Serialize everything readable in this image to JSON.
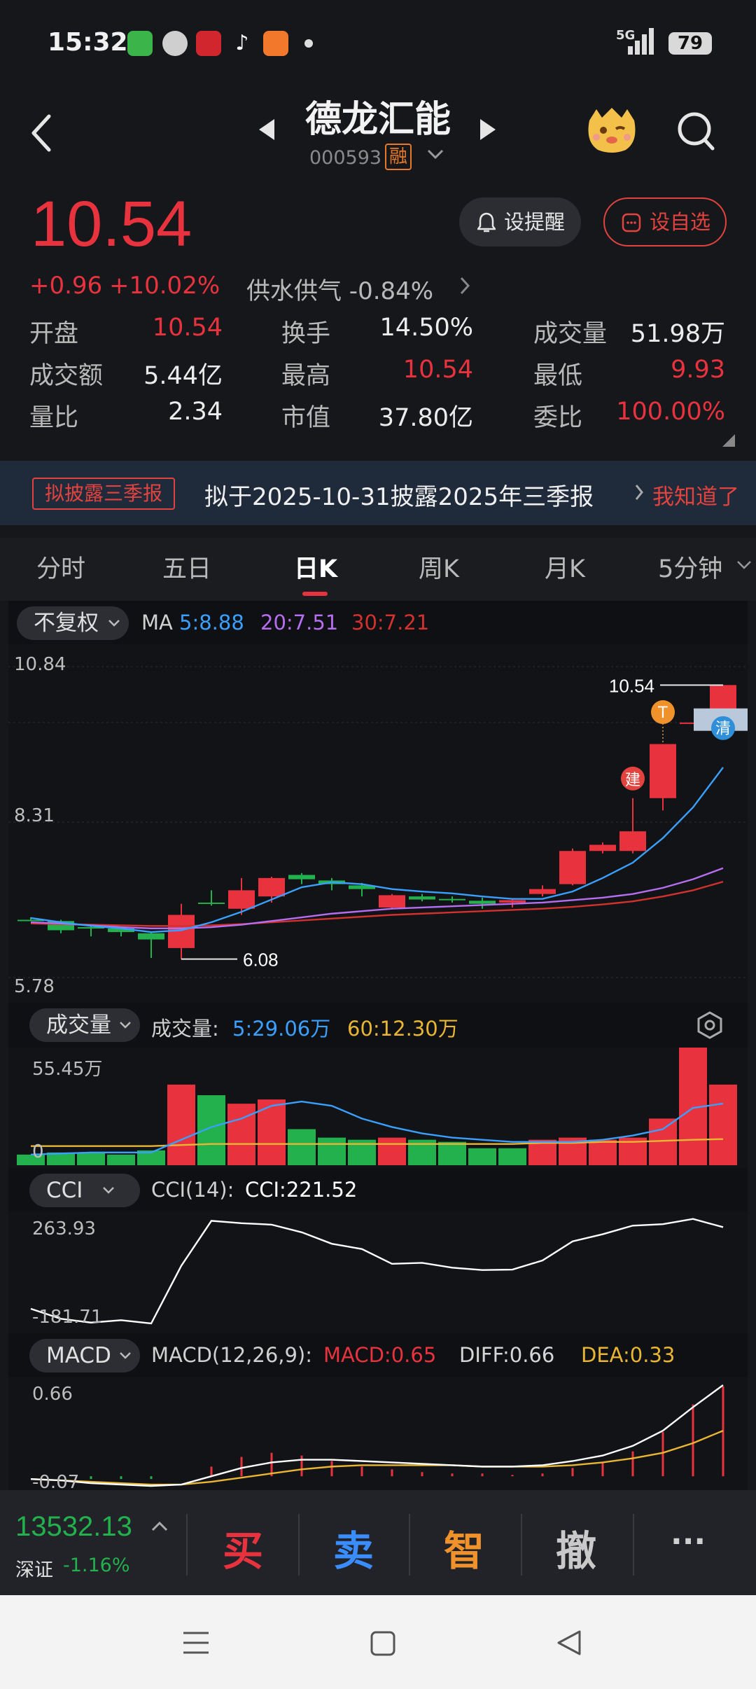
{
  "status_bar": {
    "time": "15:32",
    "network": "5G",
    "battery": "79",
    "app_icons": [
      "message-icon",
      "photo-icon",
      "cms-app-icon",
      "tiktok-icon",
      "video-app-icon"
    ]
  },
  "header": {
    "title": "德龙汇能",
    "code": "000593",
    "margin_badge": "融"
  },
  "quote": {
    "price": "10.54",
    "change": "+0.96",
    "change_pct": "+10.02%",
    "sector": "供水供气 -0.84%",
    "alert_button": "设提醒",
    "fav_button": "设自选"
  },
  "stats": [
    {
      "label": "开盘",
      "value": "10.54",
      "color": "#e8333f"
    },
    {
      "label": "换手",
      "value": "14.50%",
      "color": "#ececec"
    },
    {
      "label": "成交量",
      "value": "51.98万",
      "color": "#ececec"
    },
    {
      "label": "成交额",
      "value": "5.44亿",
      "color": "#ececec"
    },
    {
      "label": "最高",
      "value": "10.54",
      "color": "#e8333f"
    },
    {
      "label": "最低",
      "value": "9.93",
      "color": "#e8333f"
    },
    {
      "label": "量比",
      "value": "2.34",
      "color": "#ececec"
    },
    {
      "label": "市值",
      "value": "37.80亿",
      "color": "#ececec"
    },
    {
      "label": "委比",
      "value": "100.00%",
      "color": "#e8333f"
    }
  ],
  "notice": {
    "tag": "拟披露三季报",
    "text": "拟于2025-10-31披露2025年三季报",
    "dismiss": "我知道了"
  },
  "tabs": [
    "分时",
    "五日",
    "日K",
    "周K",
    "月K",
    "5分钟"
  ],
  "active_tab": "日K",
  "kline": {
    "adjust": "不复权",
    "ma_label": "MA",
    "ma5": "5:8.88",
    "ma20": "20:7.51",
    "ma30": "30:7.21",
    "y_high": "10.84",
    "y_mid": "8.31",
    "y_low": "5.78",
    "max_label": "10.54",
    "min_label": "6.08",
    "marker_build": "建",
    "marker_t": "T",
    "marker_clear": "清"
  },
  "volume": {
    "selector": "成交量",
    "label": "成交量:",
    "ma5": "5:29.06万",
    "ma60": "60:12.30万",
    "y_top": "55.45万",
    "y_zero": "0"
  },
  "cci": {
    "selector": "CCI",
    "params": "CCI(14):",
    "value": "CCI:221.52",
    "y_top": "263.93",
    "y_bottom": "-181.71"
  },
  "macd": {
    "selector": "MACD",
    "params": "MACD(12,26,9):",
    "macd": "MACD:0.65",
    "diff": "DIFF:0.66",
    "dea": "DEA:0.33",
    "y_top": "0.66",
    "y_bottom": "-0.07"
  },
  "bottom": {
    "index_value": "13532.13",
    "index_name": "深证",
    "index_change": "-1.16%",
    "buy": "买",
    "sell": "卖",
    "smart": "智",
    "cancel": "撤",
    "more": "···"
  },
  "chart_data": [
    {
      "type": "candlestick",
      "title": "",
      "ylim": [
        5.78,
        10.84
      ],
      "candles": [
        {
          "o": 6.72,
          "c": 6.72,
          "h": 6.76,
          "l": 6.7,
          "up": false
        },
        {
          "o": 6.7,
          "c": 6.55,
          "h": 6.72,
          "l": 6.5,
          "up": false
        },
        {
          "o": 6.6,
          "c": 6.58,
          "h": 6.62,
          "l": 6.45,
          "up": false
        },
        {
          "o": 6.58,
          "c": 6.52,
          "h": 6.6,
          "l": 6.45,
          "up": false
        },
        {
          "o": 6.5,
          "c": 6.4,
          "h": 6.52,
          "l": 6.1,
          "up": false
        },
        {
          "o": 6.26,
          "c": 6.8,
          "h": 6.98,
          "l": 6.08,
          "up": true
        },
        {
          "o": 6.98,
          "c": 7.0,
          "h": 7.2,
          "l": 6.95,
          "up": false
        },
        {
          "o": 6.9,
          "c": 7.2,
          "h": 7.4,
          "l": 6.8,
          "up": true
        },
        {
          "o": 7.1,
          "c": 7.4,
          "h": 7.42,
          "l": 7.0,
          "up": true
        },
        {
          "o": 7.45,
          "c": 7.38,
          "h": 7.48,
          "l": 7.3,
          "up": false
        },
        {
          "o": 7.36,
          "c": 7.3,
          "h": 7.4,
          "l": 7.2,
          "up": false
        },
        {
          "o": 7.28,
          "c": 7.22,
          "h": 7.32,
          "l": 7.1,
          "up": false
        },
        {
          "o": 6.92,
          "c": 7.12,
          "h": 7.14,
          "l": 6.9,
          "up": true
        },
        {
          "o": 7.1,
          "c": 7.05,
          "h": 7.14,
          "l": 7.02,
          "up": false
        },
        {
          "o": 7.06,
          "c": 7.04,
          "h": 7.1,
          "l": 7.0,
          "up": false
        },
        {
          "o": 7.03,
          "c": 6.98,
          "h": 7.08,
          "l": 6.9,
          "up": false
        },
        {
          "o": 7.0,
          "c": 7.04,
          "h": 7.06,
          "l": 6.92,
          "up": true
        },
        {
          "o": 7.14,
          "c": 7.22,
          "h": 7.28,
          "l": 7.1,
          "up": true
        },
        {
          "o": 7.3,
          "c": 7.84,
          "h": 7.88,
          "l": 7.28,
          "up": true
        },
        {
          "o": 7.84,
          "c": 7.94,
          "h": 7.98,
          "l": 7.8,
          "up": true
        },
        {
          "o": 7.84,
          "c": 8.16,
          "h": 8.7,
          "l": 7.8,
          "up": true
        },
        {
          "o": 8.7,
          "c": 9.58,
          "h": 9.58,
          "l": 8.5,
          "up": true
        },
        {
          "o": 9.93,
          "c": 9.93,
          "h": 9.93,
          "l": 9.93,
          "up": true
        },
        {
          "o": 9.93,
          "c": 10.54,
          "h": 10.54,
          "l": 9.93,
          "up": true
        }
      ],
      "ma5": [
        6.75,
        6.68,
        6.62,
        6.58,
        6.52,
        6.55,
        6.68,
        6.85,
        7.05,
        7.25,
        7.33,
        7.3,
        7.22,
        7.18,
        7.15,
        7.1,
        7.06,
        7.06,
        7.18,
        7.4,
        7.65,
        8.05,
        8.55,
        9.2
      ],
      "ma20": [
        6.68,
        6.66,
        6.63,
        6.6,
        6.58,
        6.58,
        6.6,
        6.64,
        6.7,
        6.76,
        6.82,
        6.86,
        6.9,
        6.92,
        6.94,
        6.96,
        6.98,
        7.0,
        7.04,
        7.08,
        7.14,
        7.24,
        7.38,
        7.56
      ],
      "ma30": [
        6.66,
        6.65,
        6.64,
        6.63,
        6.62,
        6.62,
        6.63,
        6.65,
        6.68,
        6.71,
        6.74,
        6.77,
        6.8,
        6.82,
        6.84,
        6.86,
        6.88,
        6.9,
        6.93,
        6.97,
        7.02,
        7.1,
        7.2,
        7.34
      ]
    },
    {
      "type": "bar",
      "title": "成交量",
      "ylim": [
        0,
        55.45
      ],
      "values": [
        5,
        6,
        6,
        5,
        7,
        38,
        33,
        29,
        31,
        17,
        13,
        12,
        13,
        12,
        11,
        8,
        8,
        12,
        13,
        12,
        13,
        22,
        55.45,
        38
      ],
      "up": [
        false,
        false,
        false,
        false,
        false,
        true,
        false,
        true,
        true,
        false,
        false,
        false,
        true,
        false,
        false,
        false,
        false,
        true,
        true,
        true,
        true,
        true,
        true,
        true
      ],
      "ma5": [
        5,
        5.5,
        6,
        6,
        6,
        12,
        18,
        22,
        28,
        30,
        28,
        22,
        18,
        15,
        13,
        12,
        11,
        11,
        11,
        12,
        14,
        17,
        27,
        29.06
      ],
      "ma60": [
        9,
        9,
        9,
        9,
        9,
        9.5,
        10,
        10,
        10,
        10,
        10,
        10,
        10,
        10,
        10,
        10,
        10,
        10.5,
        10.5,
        11,
        11,
        11.5,
        12,
        12.3
      ]
    },
    {
      "type": "line",
      "title": "CCI(14)",
      "ylim": [
        -181.71,
        263.93
      ],
      "values": [
        -120,
        -162,
        -178,
        -168,
        -181.71,
        60,
        248,
        238,
        232,
        200,
        152,
        130,
        68,
        72,
        52,
        42,
        44,
        82,
        162,
        192,
        228,
        234,
        256,
        221.52
      ]
    },
    {
      "type": "line",
      "title": "MACD(12,26,9)",
      "ylim": [
        -0.07,
        0.66
      ],
      "diff": [
        -0.02,
        -0.03,
        -0.05,
        -0.06,
        -0.07,
        -0.06,
        0.0,
        0.06,
        0.1,
        0.12,
        0.12,
        0.11,
        0.1,
        0.09,
        0.08,
        0.07,
        0.07,
        0.08,
        0.11,
        0.15,
        0.22,
        0.33,
        0.5,
        0.66
      ],
      "dea": [
        -0.02,
        -0.03,
        -0.04,
        -0.05,
        -0.06,
        -0.06,
        -0.04,
        -0.01,
        0.02,
        0.05,
        0.07,
        0.08,
        0.08,
        0.08,
        0.08,
        0.07,
        0.07,
        0.07,
        0.08,
        0.1,
        0.13,
        0.17,
        0.24,
        0.33
      ],
      "macd": [
        0.0,
        0.0,
        -0.02,
        -0.02,
        -0.02,
        0.0,
        0.07,
        0.14,
        0.17,
        0.15,
        0.11,
        0.07,
        0.05,
        0.03,
        0.02,
        0.02,
        0.01,
        0.02,
        0.06,
        0.1,
        0.18,
        0.32,
        0.52,
        0.65
      ]
    }
  ]
}
